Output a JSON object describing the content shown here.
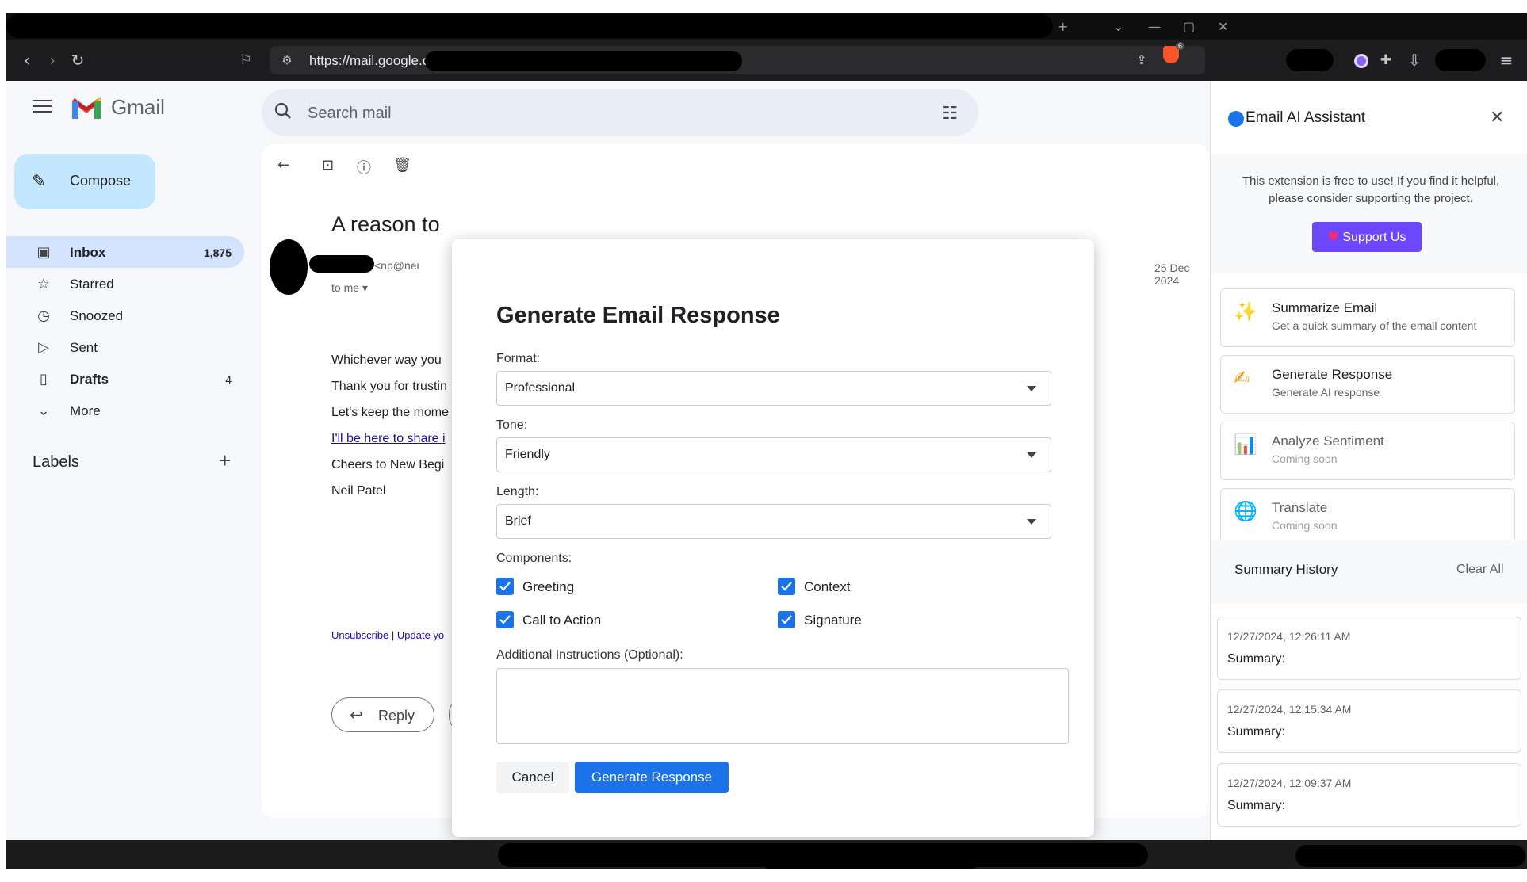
{
  "browser": {
    "url": "https://mail.google.com/",
    "brave_badge": "6",
    "window_controls": [
      "+",
      "⌄",
      "—",
      "▢",
      "✕"
    ]
  },
  "gmail": {
    "app_name": "Gmail",
    "compose_label": "Compose",
    "search_placeholder": "Search mail",
    "nav": [
      {
        "label": "Inbox",
        "count": "1,875"
      },
      {
        "label": "Starred",
        "count": ""
      },
      {
        "label": "Snoozed",
        "count": ""
      },
      {
        "label": "Sent",
        "count": ""
      },
      {
        "label": "Drafts",
        "count": "4"
      },
      {
        "label": "More",
        "count": ""
      }
    ],
    "labels_title": "Labels",
    "email": {
      "subject": "A reason to",
      "sender_email": "<np@nei",
      "to_me": "to me",
      "date": "25 Dec 2024",
      "lines": [
        "Whichever way you",
        "Thank you for trustin",
        "Let's keep the mome",
        "I'll be here to share i",
        "Cheers to New Begi",
        "Neil Patel"
      ],
      "footer_unsubscribe": "Unsubscribe",
      "footer_separator": " | ",
      "footer_update": "Update yo",
      "reply_label": "Reply"
    }
  },
  "dialog": {
    "title": "Generate Email Response",
    "format_label": "Format:",
    "format_value": "Professional",
    "tone_label": "Tone:",
    "tone_value": "Friendly",
    "length_label": "Length:",
    "length_value": "Brief",
    "components_label": "Components:",
    "components": [
      {
        "label": "Greeting",
        "checked": true
      },
      {
        "label": "Context",
        "checked": true
      },
      {
        "label": "Call to Action",
        "checked": true
      },
      {
        "label": "Signature",
        "checked": true
      }
    ],
    "instructions_label": "Additional Instructions (Optional):",
    "instructions_value": "",
    "cancel_label": "Cancel",
    "generate_label": "Generate Response"
  },
  "extension": {
    "title": "Email AI Assistant",
    "close_glyph": "✕",
    "promo_text": "This extension is free to use! If you find it helpful, please consider supporting the project.",
    "support_label": "Support Us",
    "features": [
      {
        "icon": "sparkles-icon",
        "glyph": "✨",
        "title": "Summarize Email",
        "subtitle": "Get a quick summary of the email content"
      },
      {
        "icon": "writing-hand-icon",
        "glyph": "✍",
        "title": "Generate Response",
        "subtitle": "Generate AI response"
      },
      {
        "icon": "bar-chart-icon",
        "glyph": "📊",
        "title": "Analyze Sentiment",
        "subtitle": "Coming soon"
      },
      {
        "icon": "globe-icon",
        "glyph": "🌐",
        "title": "Translate",
        "subtitle": "Coming soon"
      }
    ],
    "history_title": "Summary History",
    "clear_all_label": "Clear All",
    "history": [
      {
        "date": "12/27/2024, 12:26:11 AM",
        "summary_label": "Summary:"
      },
      {
        "date": "12/27/2024, 12:15:34 AM",
        "summary_label": "Summary:"
      },
      {
        "date": "12/27/2024, 12:09:37 AM",
        "summary_label": "Summary:"
      }
    ]
  },
  "colors": {
    "accent": "#1a73e8",
    "support_button": "#6c47ff",
    "inbox_highlight": "#d3e3fd",
    "compose_bg": "#c2e7ff"
  }
}
